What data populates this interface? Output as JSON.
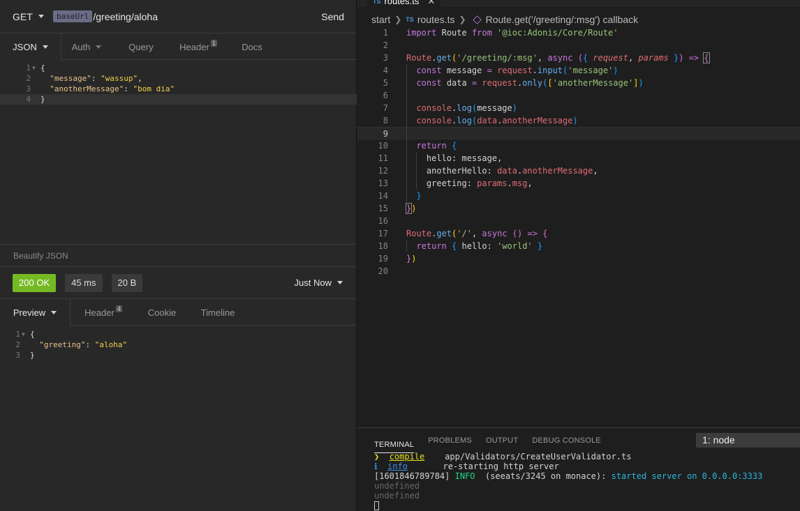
{
  "insomnia": {
    "method": "GET",
    "url_tag": "baseUrl",
    "url_path": "/greeting/aloha",
    "send_label": "Send",
    "request_tabs": [
      {
        "label": "JSON",
        "badge": ""
      },
      {
        "label": "Auth",
        "badge": ""
      },
      {
        "label": "Query",
        "badge": ""
      },
      {
        "label": "Header",
        "badge": "1"
      },
      {
        "label": "Docs",
        "badge": ""
      }
    ],
    "request_body": [
      {
        "num": "1",
        "text": "{"
      },
      {
        "num": "2",
        "key": "\"message\"",
        "value": "\"wassup\"",
        "suffix": ","
      },
      {
        "num": "3",
        "key": "\"anotherMessage\"",
        "value": "\"bom dia\"",
        "suffix": ""
      },
      {
        "num": "4",
        "text": "}"
      }
    ],
    "beautify_label": "Beautify JSON",
    "status": "200 OK",
    "time": "45 ms",
    "size": "20 B",
    "timestamp": "Just Now",
    "response_tabs": [
      {
        "label": "Preview",
        "badge": ""
      },
      {
        "label": "Header",
        "badge": "4"
      },
      {
        "label": "Cookie",
        "badge": ""
      },
      {
        "label": "Timeline",
        "badge": ""
      }
    ],
    "response_body": [
      {
        "num": "1",
        "text": "{"
      },
      {
        "num": "2",
        "key": "\"greeting\"",
        "value": "\"aloha\"",
        "suffix": ""
      },
      {
        "num": "3",
        "text": "}"
      }
    ]
  },
  "vscode": {
    "tab_label": "routes.ts",
    "breadcrumb": {
      "folder": "start",
      "file": "routes.ts",
      "symbol": "Route.get('/greeting/:msg') callback"
    },
    "line_numbers": [
      "1",
      "2",
      "3",
      "4",
      "5",
      "6",
      "7",
      "8",
      "9",
      "10",
      "11",
      "12",
      "13",
      "14",
      "15",
      "16",
      "17",
      "18",
      "19",
      "20"
    ],
    "code": {
      "l1_import": "import",
      "l1_route": "Route",
      "l1_from": "from",
      "l1_module": "'@ioc:Adonis/Core/Route'",
      "l3_route": "Route",
      "l3_get": "get",
      "l3_path": "'/greeting/:msg'",
      "l3_async": "async",
      "l3_request": "request",
      "l3_params": "params",
      "l4_const": "const",
      "l4_name": "message",
      "l4_request": "request",
      "l4_input": "input",
      "l4_arg": "'message'",
      "l5_const": "const",
      "l5_name": "data",
      "l5_request": "request",
      "l5_only": "only",
      "l5_arg": "'anotherMessage'",
      "l7_console": "console",
      "l7_log": "log",
      "l7_arg": "message",
      "l8_console": "console",
      "l8_log": "log",
      "l8_data": "data",
      "l8_prop": "anotherMessage",
      "l10_return": "return",
      "l11_key": "hello",
      "l11_val": "message",
      "l12_key": "anotherHello",
      "l12_data": "data",
      "l12_prop": "anotherMessage",
      "l13_key": "greeting",
      "l13_params": "params",
      "l13_prop": "msg",
      "l17_route": "Route",
      "l17_get": "get",
      "l17_path": "'/'",
      "l17_async": "async",
      "l18_return": "return",
      "l18_key": "hello",
      "l18_val": "'world'"
    },
    "terminal_tabs": [
      "TERMINAL",
      "PROBLEMS",
      "OUTPUT",
      "DEBUG CONSOLE"
    ],
    "terminal_select": "1: node",
    "terminal": {
      "l1_prompt": "❯",
      "l1_task": "compile",
      "l1_msg": "app/Validators/CreateUserValidator.ts",
      "l2_prompt": "ℹ",
      "l2_task": "info",
      "l2_msg": "re-starting http server",
      "l3_ts": "[1601846789784]",
      "l3_level": "INFO",
      "l3_ctx": "(seeats/3245 on monace):",
      "l3_msg": "started server on 0.0.0.0:3333",
      "l4": "undefined",
      "l5": "undefined"
    }
  },
  "colors": {
    "status_ok": "#75ba24",
    "accent_blue": "#3b8eea"
  }
}
